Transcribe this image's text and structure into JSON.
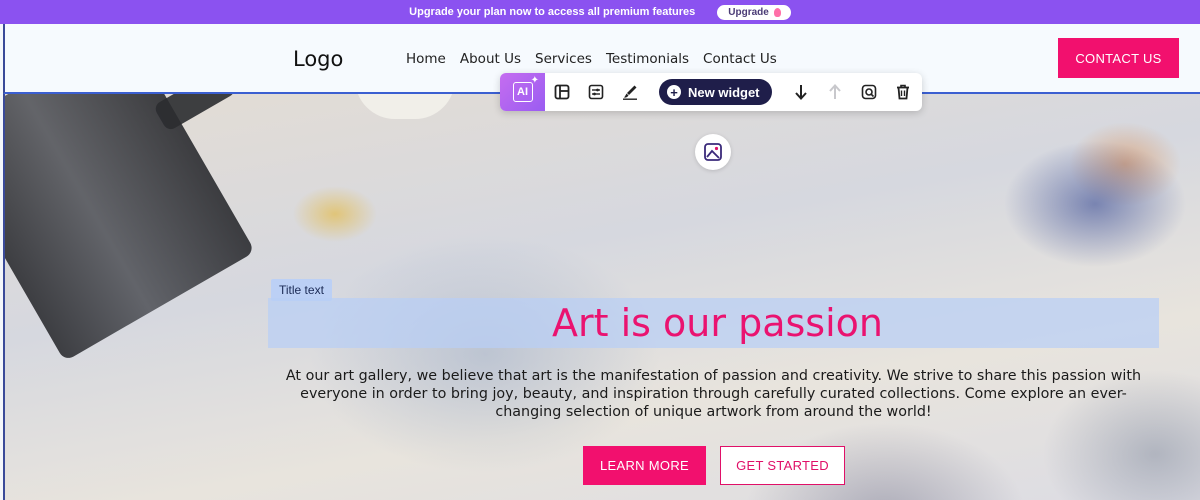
{
  "promo": {
    "text": "Upgrade your plan now to access all premium features",
    "button_label": "Upgrade"
  },
  "header": {
    "logo": "Logo",
    "nav": [
      "Home",
      "About Us",
      "Services",
      "Testimonials",
      "Contact Us"
    ],
    "cta_label": "CONTACT US"
  },
  "toolbar": {
    "ai_label": "AI",
    "new_widget_label": "New widget",
    "icons": [
      "layout-icon",
      "settings-sliders-icon",
      "brush-icon",
      "arrow-down-icon",
      "arrow-up-icon",
      "duplicate-icon",
      "trash-icon"
    ]
  },
  "hero": {
    "title_tag": "Title text",
    "title": "Art is our passion",
    "description": "At our art gallery, we believe that art is the manifestation of passion and creativity. We strive to share this passion with everyone in order to bring joy, beauty, and inspiration through carefully curated collections. Come explore an ever-changing selection of unique artwork from around the world!",
    "primary_button": "LEARN MORE",
    "secondary_button": "GET STARTED"
  },
  "colors": {
    "promo_bg": "#8b52f0",
    "accent": "#f2106e",
    "toolbar_dark": "#1f1e4a",
    "title_highlight": "#b9cff5"
  }
}
